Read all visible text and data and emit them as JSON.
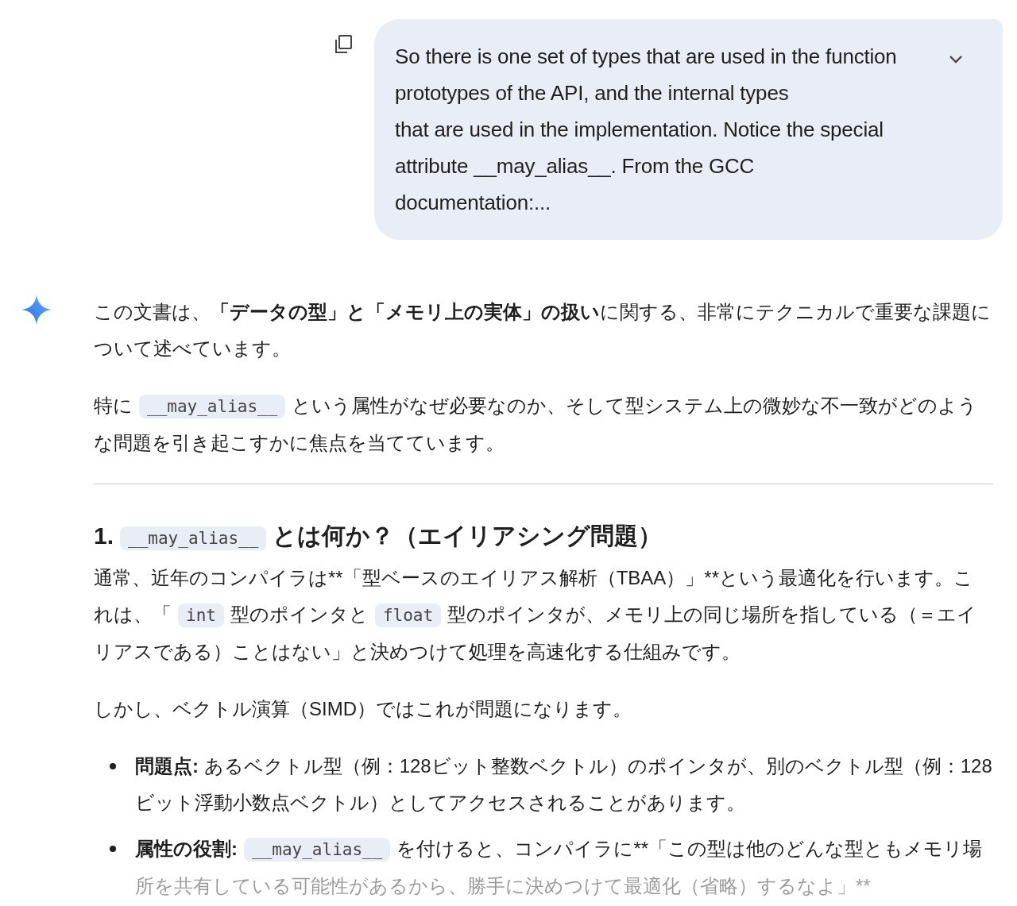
{
  "user_message": {
    "lines": [
      "So there is one set of types that are used in the function",
      "prototypes of the API, and the internal types",
      "that are used in the implementation. Notice the special",
      "attribute __may_alias__. From the GCC",
      "documentation:..."
    ],
    "expanded": false
  },
  "response": {
    "blocks": [
      {
        "kind": "paragraph",
        "segments": [
          {
            "kind": "text",
            "text": "この文書は、"
          },
          {
            "kind": "bold",
            "text": "「データの型」と「メモリ上の実体」の扱い"
          },
          {
            "kind": "text",
            "text": "に関する、非常にテクニカルで重要な課題について述べています。"
          }
        ]
      },
      {
        "kind": "paragraph",
        "segments": [
          {
            "kind": "text",
            "text": "特に"
          },
          {
            "kind": "code",
            "text": "__may_alias__"
          },
          {
            "kind": "text",
            "text": "という属性がなぜ必要なのか、そして型システム上の微妙な不一致がどのような問題を引き起こすかに焦点を当てています。"
          }
        ]
      },
      {
        "kind": "divider"
      },
      {
        "kind": "heading",
        "segments": [
          {
            "kind": "text",
            "text": "1."
          },
          {
            "kind": "code",
            "text": "__may_alias__"
          },
          {
            "kind": "text",
            "text": "とは何か？（エイリアシング問題）"
          }
        ]
      },
      {
        "kind": "paragraph",
        "segments": [
          {
            "kind": "text",
            "text": "通常、近年のコンパイラは**「型ベースのエイリアス解析（TBAA）」**という最適化を行います。これは、「"
          },
          {
            "kind": "code",
            "text": "int"
          },
          {
            "kind": "text",
            "text": "型のポインタと"
          },
          {
            "kind": "code",
            "text": "float"
          },
          {
            "kind": "text",
            "text": "型のポインタが、メモリ上の同じ場所を指している（＝エイリアスである）ことはない」と決めつけて処理を高速化する仕組みです。"
          }
        ]
      },
      {
        "kind": "paragraph",
        "segments": [
          {
            "kind": "text",
            "text": "しかし、ベクトル演算（SIMD）ではこれが問題になります。"
          }
        ]
      },
      {
        "kind": "bullets",
        "items": [
          {
            "segments": [
              {
                "kind": "bold",
                "text": "問題点:"
              },
              {
                "kind": "text",
                "text": " あるベクトル型（例：128ビット整数ベクトル）のポインタが、別のベクトル型（例：128ビット浮動小数点ベクトル）としてアクセスされることがあります。"
              }
            ]
          },
          {
            "segments": [
              {
                "kind": "bold",
                "text": "属性の役割:"
              },
              {
                "kind": "code",
                "text": "__may_alias__"
              },
              {
                "kind": "text",
                "text": "を付けると、コンパイラに**「この型は他のどんな型ともメモリ場所を共有している可能性があるから、勝手に決めつけて最適化（省略）するなよ」**"
              }
            ]
          }
        ]
      }
    ]
  }
}
